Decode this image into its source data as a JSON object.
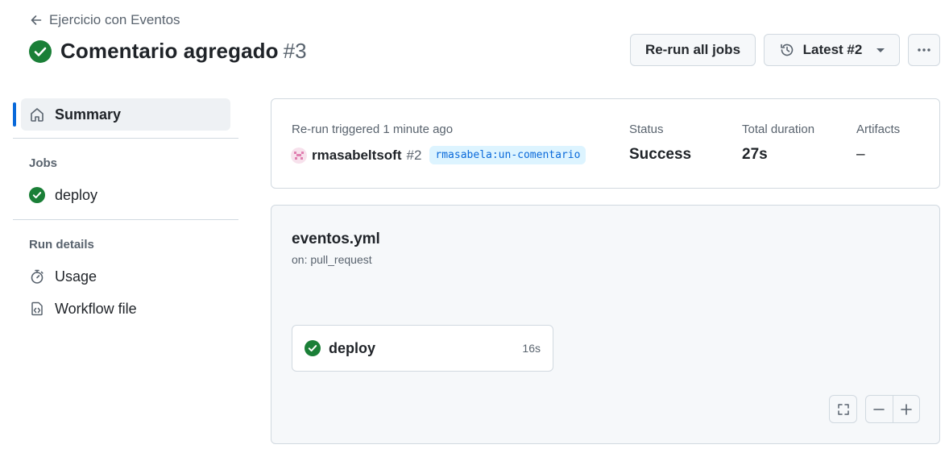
{
  "header": {
    "back_label": "Ejercicio con Eventos",
    "title": "Comentario agregado",
    "run_number": "#3",
    "rerun_label": "Re-run all jobs",
    "latest_label": "Latest #2"
  },
  "sidebar": {
    "summary_label": "Summary",
    "jobs_heading": "Jobs",
    "jobs": [
      {
        "label": "deploy",
        "status": "success"
      }
    ],
    "run_details_heading": "Run details",
    "usage_label": "Usage",
    "workflow_file_label": "Workflow file"
  },
  "summary": {
    "trigger_label": "Re-run triggered 1 minute ago",
    "user": "rmasabeltsoft",
    "run_ref": "#2",
    "branch": "rmasabela:un-comentario",
    "status_label": "Status",
    "status_value": "Success",
    "duration_label": "Total duration",
    "duration_value": "27s",
    "artifacts_label": "Artifacts",
    "artifacts_value": "–"
  },
  "workflow": {
    "file": "eventos.yml",
    "on": "on: pull_request",
    "job": {
      "name": "deploy",
      "duration": "16s",
      "status": "success"
    }
  },
  "colors": {
    "success": "#1a7f37",
    "accent": "#0969da",
    "muted": "#59636e",
    "border": "#d1d9e0"
  }
}
